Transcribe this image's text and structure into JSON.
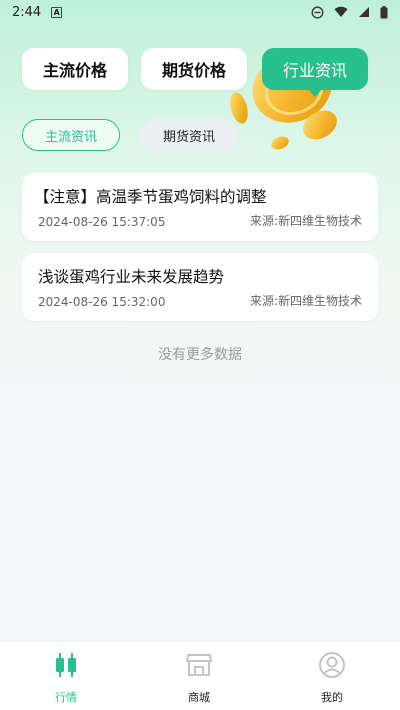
{
  "status_bar": {
    "time": "2:44",
    "notification_icon": "A"
  },
  "top_tabs": [
    {
      "label": "主流价格",
      "active": false
    },
    {
      "label": "期货价格",
      "active": false
    },
    {
      "label": "行业资讯",
      "active": true
    }
  ],
  "sub_tabs": [
    {
      "label": "主流资讯",
      "active": true
    },
    {
      "label": "期货资讯",
      "active": false
    }
  ],
  "news": [
    {
      "title": "【注意】高温季节蛋鸡饲料的调整",
      "time": "2024-08-26 15:37:05",
      "source": "来源:新四维生物技术"
    },
    {
      "title": "浅谈蛋鸡行业未来发展趋势",
      "time": "2024-08-26 15:32:00",
      "source": "来源:新四维生物技术"
    }
  ],
  "no_more_text": "没有更多数据",
  "bottom_nav": [
    {
      "label": "行情",
      "icon": "candlestick-icon",
      "active": true
    },
    {
      "label": "商城",
      "icon": "store-icon",
      "active": false
    },
    {
      "label": "我的",
      "icon": "user-icon",
      "active": false
    }
  ],
  "colors": {
    "accent": "#27c08c",
    "background": "#f5f6f8",
    "gradient_top": "#bff0d9",
    "coin_gold": "#f3b62a"
  }
}
